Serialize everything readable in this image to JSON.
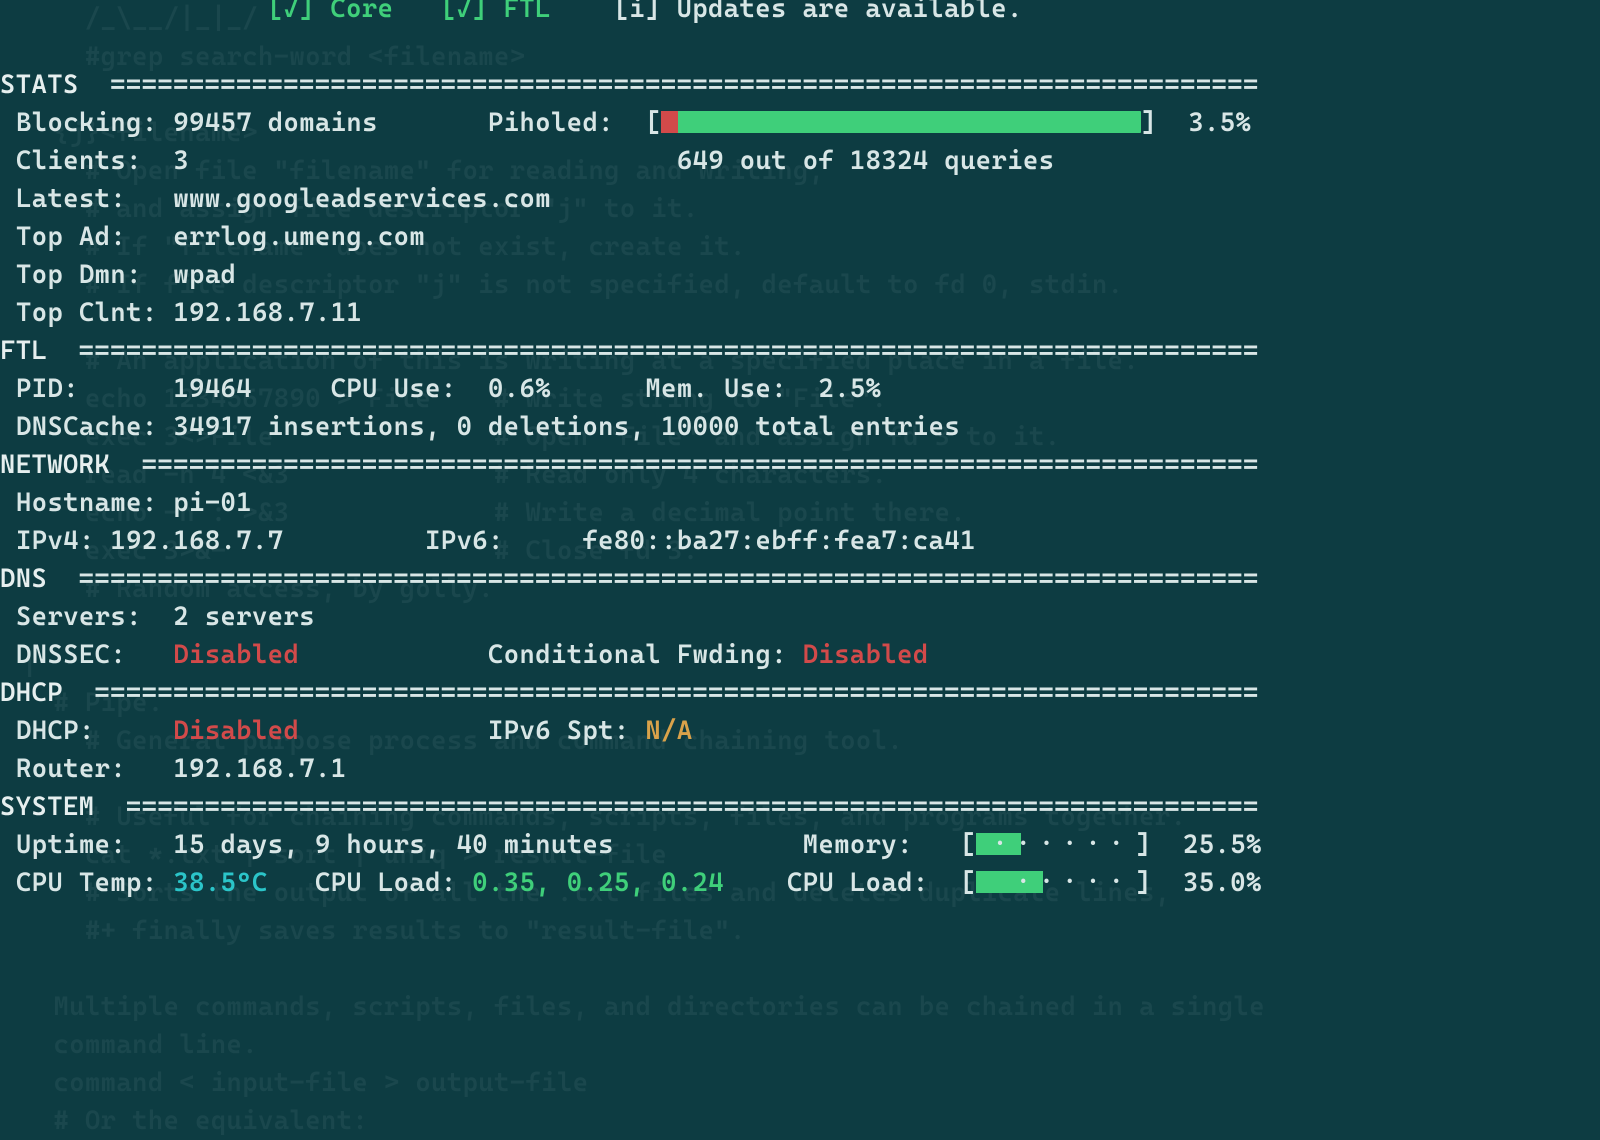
{
  "header": {
    "core_checked": "[✓] Core",
    "ftl_checked": "[✓] FTL",
    "updates": "[i] Updates are available."
  },
  "stats": {
    "title": "STATS",
    "rule": "=========================================================================",
    "blocking_label": "Blocking:",
    "blocking_value": "99457 domains",
    "piholed_label": "Piholed:",
    "piholed_pct": "3.5%",
    "piholed_detail": "649 out of 18324 queries",
    "clients_label": "Clients:",
    "clients_value": "3",
    "latest_label": "Latest:",
    "latest_value": "www.googleadservices.com",
    "topad_label": "Top Ad:",
    "topad_value": "errlog.umeng.com",
    "topdmn_label": "Top Dmn:",
    "topdmn_value": "wpad",
    "topclnt_label": "Top Clnt:",
    "topclnt_value": "192.168.7.11"
  },
  "ftl": {
    "title": "FTL",
    "rule": "===========================================================================",
    "pid_label": "PID:",
    "pid_value": "19464",
    "cpu_label": "CPU Use:",
    "cpu_value": "0.6%",
    "mem_label": "Mem. Use:",
    "mem_value": "2.5%",
    "dnscache_label": "DNSCache:",
    "dnscache_value": "34917 insertions, 0 deletions, 10000 total entries"
  },
  "network": {
    "title": "NETWORK",
    "rule": "=======================================================================",
    "host_label": "Hostname:",
    "host_value": "pi-01",
    "ipv4_label": "IPv4:",
    "ipv4_value": "192.168.7.7",
    "ipv6_label": "IPv6:",
    "ipv6_value": "fe80::ba27:ebff:fea7:ca41"
  },
  "dns": {
    "title": "DNS",
    "rule": "===========================================================================",
    "servers_label": "Servers:",
    "servers_value": "2 servers",
    "dnssec_label": "DNSSEC:",
    "dnssec_value": "Disabled",
    "cfwd_label": "Conditional Fwding:",
    "cfwd_value": "Disabled"
  },
  "dhcp": {
    "title": "DHCP",
    "rule": "==========================================================================",
    "dhcp_label": "DHCP:",
    "dhcp_value": "Disabled",
    "ipv6s_label": "IPv6 Spt:",
    "ipv6s_value": "N/A",
    "router_label": "Router:",
    "router_value": "192.168.7.1"
  },
  "system": {
    "title": "SYSTEM",
    "rule": "========================================================================",
    "uptime_label": "Uptime:",
    "uptime_value": "15 days, 9 hours, 40 minutes",
    "mem_label": "Memory:",
    "mem_pct": "25.5%",
    "mem_fill_pct": 28,
    "temp_label": "CPU Temp:",
    "temp_value": "38.5°C",
    "load_label": "CPU Load:",
    "load_values": "0.35, 0.25, 0.24",
    "load2_label": "CPU Load:",
    "load2_pct": "35.0%",
    "load2_fill_pct": 42
  },
  "ghost_lines": [
    "    /_\\__/|_|_/",
    "    #grep search-word <filename>",
    "",
    "  {j}<filename>",
    "    # Open file \"filename\" for reading and writing,",
    "    # and assign file descriptor \"j\" to it.",
    "    # If \"filename\" does not exist, create it.",
    "    # If file descriptor \"j\" is not specified, default to fd 0, stdin.",
    "",
    "    # An application of this is writing at a specified place in a file.",
    "    echo 1234567890 > File    # Write string to \"File\".",
    "    exec 3<>File              # Open \"File\" and assign fd 3 to it.",
    "    read -n 4 <&3             # Read only 4 characters.",
    "    echo -n : >&3             # Write a decimal point there.",
    "    exec 3>&-                 # Close fd 3.",
    "    # Random access, by golly.",
    "",
    "|",
    "  # Pipe.",
    "    # General purpose process and command chaining tool.",
    "",
    "    # Useful for chaining commands, scripts, files, and programs together.",
    "    cat *.txt | sort | uniq > result-file",
    "    # Sorts the output of all the .txt files and deletes duplicate lines,",
    "    #+ finally saves results to \"result-file\".",
    "",
    "  Multiple commands, scripts, files, and directories can be chained in a single",
    "  command line.",
    "  command < input-file > output-file",
    "  # Or the equivalent:"
  ]
}
